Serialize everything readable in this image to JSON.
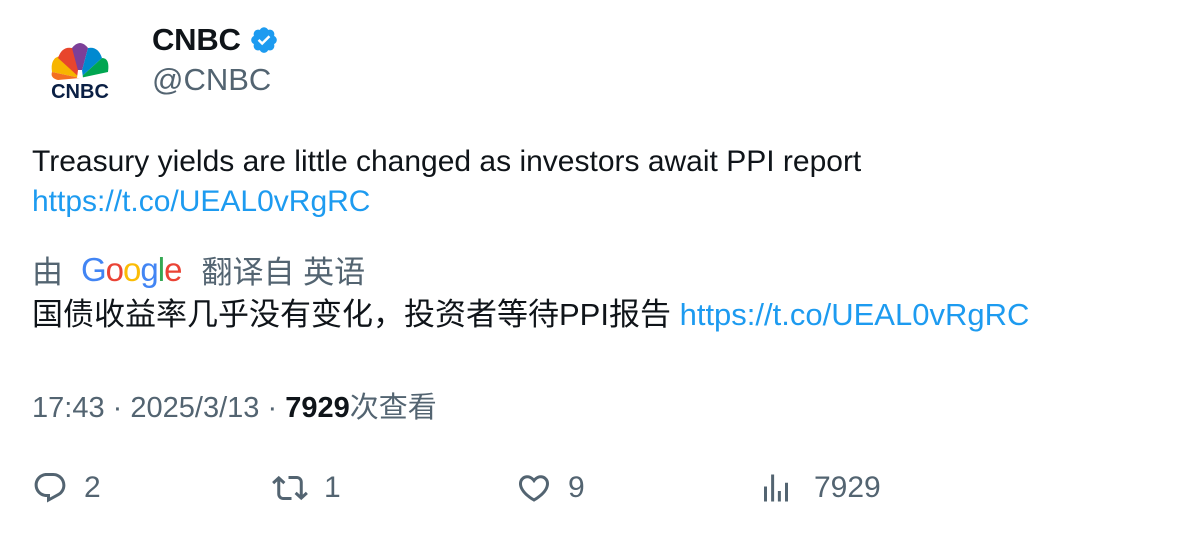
{
  "author": {
    "display_name": "CNBC",
    "handle": "@CNBC",
    "logo_text": "CNBC",
    "verified_color": "#1d9bf0"
  },
  "tweet": {
    "text": "Treasury yields are little changed as investors await PPI report",
    "link": "https://t.co/UEAL0vRgRC"
  },
  "translation": {
    "by_label": "由",
    "provider": "Google",
    "from_label": "翻译自 英语",
    "text": "国债收益率几乎没有变化，投资者等待PPI报告",
    "link": "https://t.co/UEAL0vRgRC"
  },
  "meta": {
    "time": "17:43",
    "separator": "·",
    "date": "2025/3/13",
    "views_count": "7929",
    "views_label": "次查看"
  },
  "actions": {
    "reply_count": "2",
    "retweet_count": "1",
    "like_count": "9",
    "views_count": "7929"
  },
  "colors": {
    "link": "#1d9bf0",
    "secondary_text": "#536471",
    "primary_text": "#0f1419"
  }
}
